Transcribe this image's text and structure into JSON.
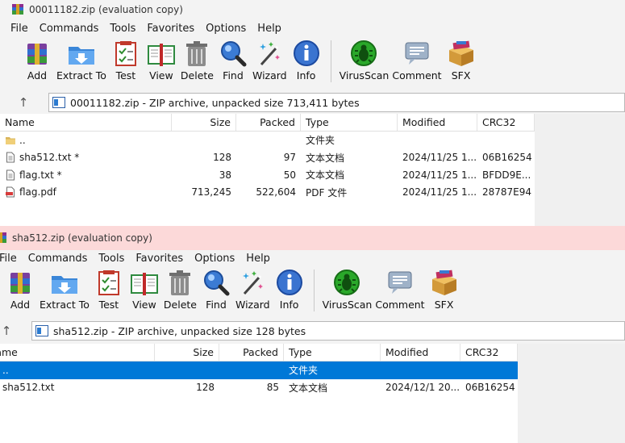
{
  "colors": {
    "accent_selection": "#0078d7",
    "inactive_title": "#fcd9d9"
  },
  "window1": {
    "title": "00011182.zip (evaluation copy)",
    "menu": [
      "File",
      "Commands",
      "Tools",
      "Favorites",
      "Options",
      "Help"
    ],
    "toolbar": [
      "Add",
      "Extract To",
      "Test",
      "View",
      "Delete",
      "Find",
      "Wizard",
      "Info",
      "VirusScan",
      "Comment",
      "SFX"
    ],
    "address": "00011182.zip - ZIP archive, unpacked size 713,411 bytes",
    "columns": [
      "Name",
      "Size",
      "Packed",
      "Type",
      "Modified",
      "CRC32"
    ],
    "rows": [
      {
        "name": "..",
        "size": "",
        "packed": "",
        "type": "文件夹",
        "modified": "",
        "crc": "",
        "icon": "folder-icon"
      },
      {
        "name": "sha512.txt *",
        "size": "128",
        "packed": "97",
        "type": "文本文档",
        "modified": "2024/11/25 1...",
        "crc": "06B16254",
        "icon": "text-file-icon"
      },
      {
        "name": "flag.txt *",
        "size": "38",
        "packed": "50",
        "type": "文本文档",
        "modified": "2024/11/25 1...",
        "crc": "BFDD9E...",
        "icon": "text-file-icon"
      },
      {
        "name": "flag.pdf",
        "size": "713,245",
        "packed": "522,604",
        "type": "PDF 文件",
        "modified": "2024/11/25 1...",
        "crc": "28787E94",
        "icon": "pdf-file-icon"
      }
    ]
  },
  "window2": {
    "title": "sha512.zip (evaluation copy)",
    "menu": [
      "File",
      "Commands",
      "Tools",
      "Favorites",
      "Options",
      "Help"
    ],
    "toolbar": [
      "Add",
      "Extract To",
      "Test",
      "View",
      "Delete",
      "Find",
      "Wizard",
      "Info",
      "VirusScan",
      "Comment",
      "SFX"
    ],
    "address": "sha512.zip - ZIP archive, unpacked size 128 bytes",
    "columns": [
      "Name",
      "Size",
      "Packed",
      "Type",
      "Modified",
      "CRC32"
    ],
    "rows": [
      {
        "name": "..",
        "size": "",
        "packed": "",
        "type": "文件夹",
        "modified": "",
        "crc": "",
        "icon": "folder-icon",
        "selected": true
      },
      {
        "name": "sha512.txt",
        "size": "128",
        "packed": "85",
        "type": "文本文档",
        "modified": "2024/12/1 20...",
        "crc": "06B16254",
        "icon": "text-file-icon"
      }
    ]
  }
}
